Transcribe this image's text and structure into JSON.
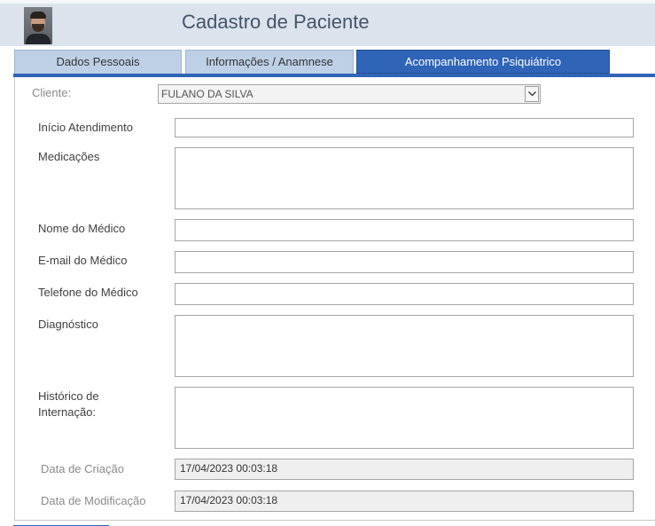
{
  "header": {
    "title": "Cadastro de Paciente"
  },
  "tabs": [
    {
      "label": "Dados Pessoais"
    },
    {
      "label": "Informações / Anamnese"
    },
    {
      "label": "Acompanhamento Psiquiátrico"
    }
  ],
  "form": {
    "cliente_label": "Cliente:",
    "cliente_value": "FULANO DA SILVA",
    "inicio_label": "Início Atendimento",
    "inicio_value": "",
    "medicacoes_label": "Medicações",
    "medicacoes_value": "",
    "nome_medico_label": "Nome do Médico",
    "nome_medico_value": "",
    "email_medico_label": "E-mail do Médico",
    "email_medico_value": "",
    "telefone_medico_label": "Telefone do Médico",
    "telefone_medico_value": "",
    "diagnostico_label": "Diagnóstico",
    "diagnostico_value": "",
    "historico_label_1": "Histórico de",
    "historico_label_2": "Internação:",
    "historico_value": "",
    "data_criacao_label": "Data de Criação",
    "data_criacao_value": "17/04/2023 00:03:18",
    "data_modificacao_label": "Data de Modificação",
    "data_modificacao_value": "17/04/2023 00:03:18"
  },
  "icons": {
    "avatar": "user-photo",
    "dropdown": "chevron-down-icon"
  },
  "colors": {
    "accent": "#2f64b7",
    "tab_inactive": "#bed0e6",
    "header_bg": "#dce3ec",
    "title": "#44546a"
  }
}
